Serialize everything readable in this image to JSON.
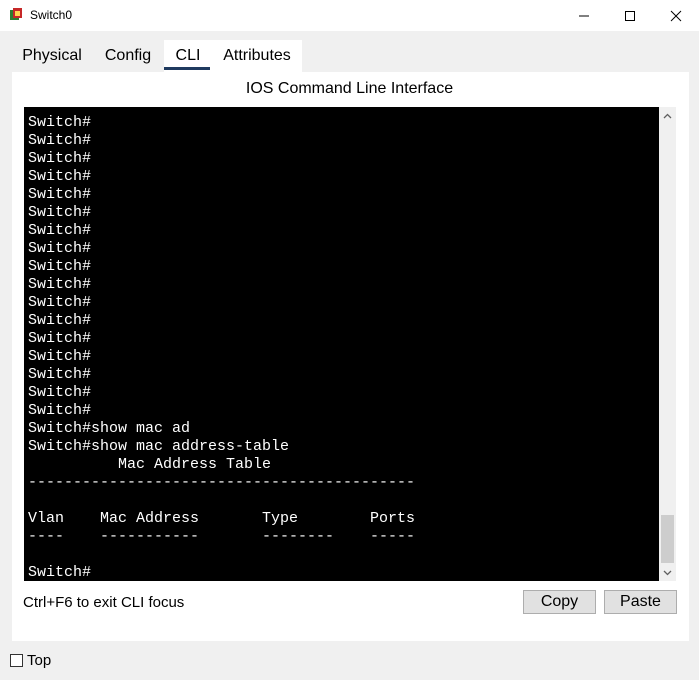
{
  "window": {
    "title": "Switch0",
    "controls": {
      "minimize": "—",
      "maximize": "☐",
      "close": "✕"
    }
  },
  "tabs": [
    {
      "label": "Physical",
      "active": false
    },
    {
      "label": "Config",
      "active": false
    },
    {
      "label": "CLI",
      "active": true
    },
    {
      "label": "Attributes",
      "active": false
    }
  ],
  "cli": {
    "title": "IOS Command Line Interface",
    "lines": [
      "Switch#",
      "Switch#",
      "Switch#",
      "Switch#",
      "Switch#",
      "Switch#",
      "Switch#",
      "Switch#",
      "Switch#",
      "Switch#",
      "Switch#",
      "Switch#",
      "Switch#",
      "Switch#",
      "Switch#",
      "Switch#",
      "Switch#",
      "Switch#show mac ad",
      "Switch#show mac address-table",
      "          Mac Address Table",
      "-------------------------------------------",
      "",
      "Vlan    Mac Address       Type        Ports",
      "----    -----------       --------    -----",
      "",
      "Switch#"
    ],
    "scroll_up_icon": "chevron-up-icon",
    "scroll_down_icon": "chevron-down-icon"
  },
  "footer": {
    "hint": "Ctrl+F6 to exit CLI focus",
    "copy_label": "Copy",
    "paste_label": "Paste"
  },
  "top_checkbox": {
    "label": "Top",
    "checked": false
  }
}
